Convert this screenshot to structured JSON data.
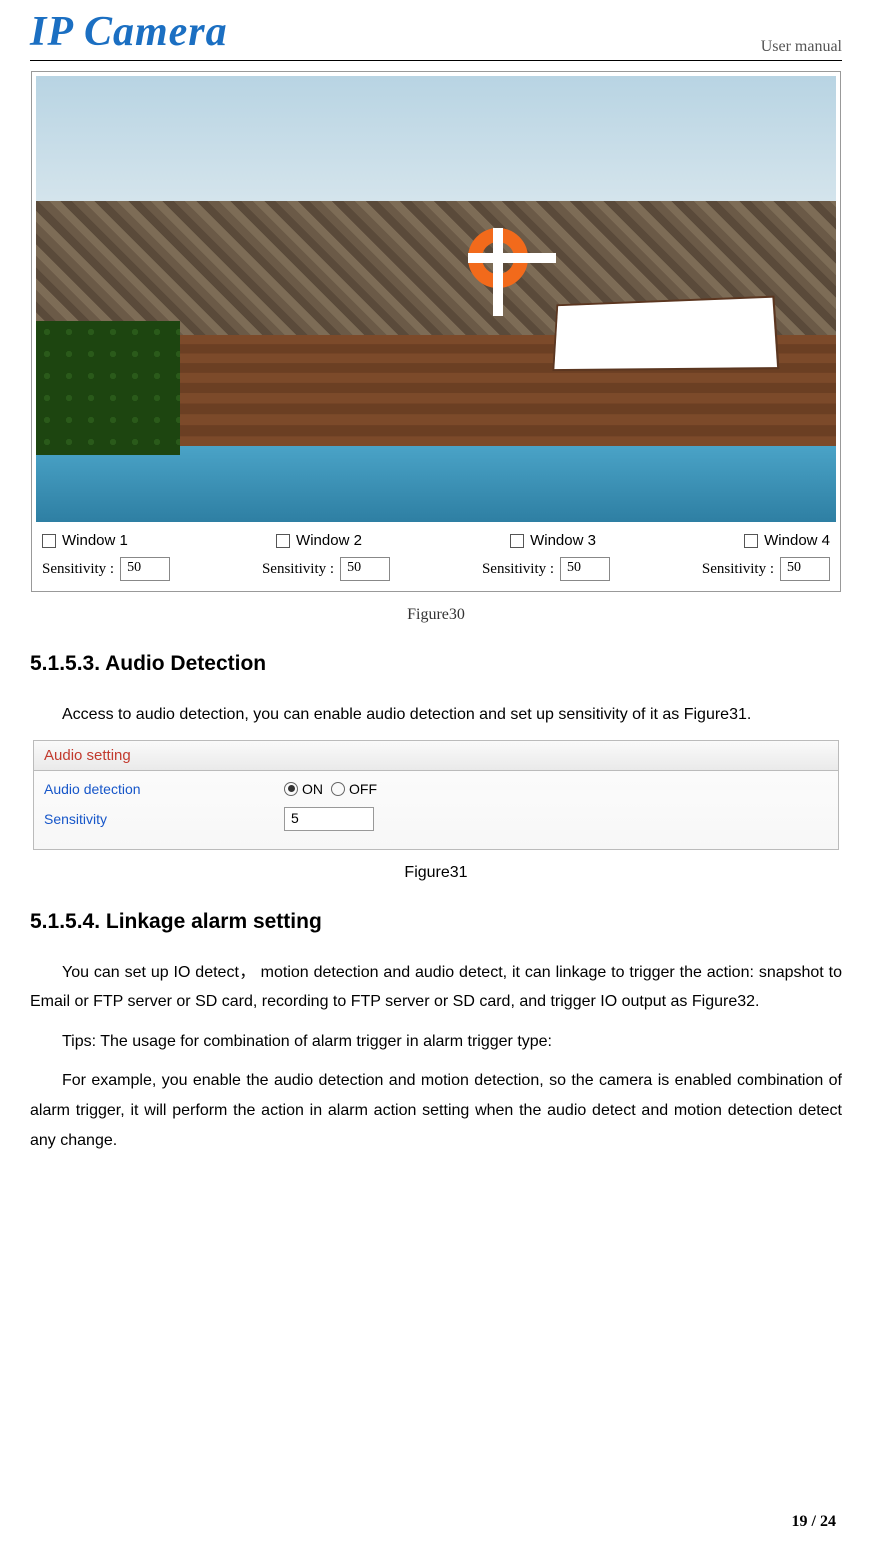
{
  "header": {
    "logo": "IP Camera",
    "manual": "User manual"
  },
  "figure30": {
    "windows": [
      {
        "label": "Window 1",
        "sens_label": "Sensitivity :",
        "value": "50"
      },
      {
        "label": "Window 2",
        "sens_label": "Sensitivity :",
        "value": "50"
      },
      {
        "label": "Window 3",
        "sens_label": "Sensitivity :",
        "value": "50"
      },
      {
        "label": "Window 4",
        "sens_label": "Sensitivity :",
        "value": "50"
      }
    ],
    "caption": "Figure30"
  },
  "section1": {
    "heading": "5.1.5.3. Audio Detection",
    "para": "Access to audio detection, you can enable audio detection and set up sensitivity of it as Figure31."
  },
  "audio_panel": {
    "title": "Audio setting",
    "row1_label": "Audio detection",
    "on": "ON",
    "off": "OFF",
    "row2_label": "Sensitivity",
    "value": "5",
    "caption": "Figure31"
  },
  "section2": {
    "heading": "5.1.5.4. Linkage alarm setting",
    "para1": "You can set up IO detect，  motion detection and audio detect, it can linkage to trigger the action: snapshot to Email or FTP server or SD card, recording to FTP server or SD card, and trigger IO output as Figure32.",
    "para2": "Tips: The usage for combination of alarm trigger in alarm trigger type:",
    "para3": "For example, you enable the audio detection and motion detection, so the camera is enabled combination of alarm trigger, it will perform the action in alarm action setting when the audio detect and motion detection detect any change."
  },
  "footer": {
    "page": "19 / 24"
  }
}
